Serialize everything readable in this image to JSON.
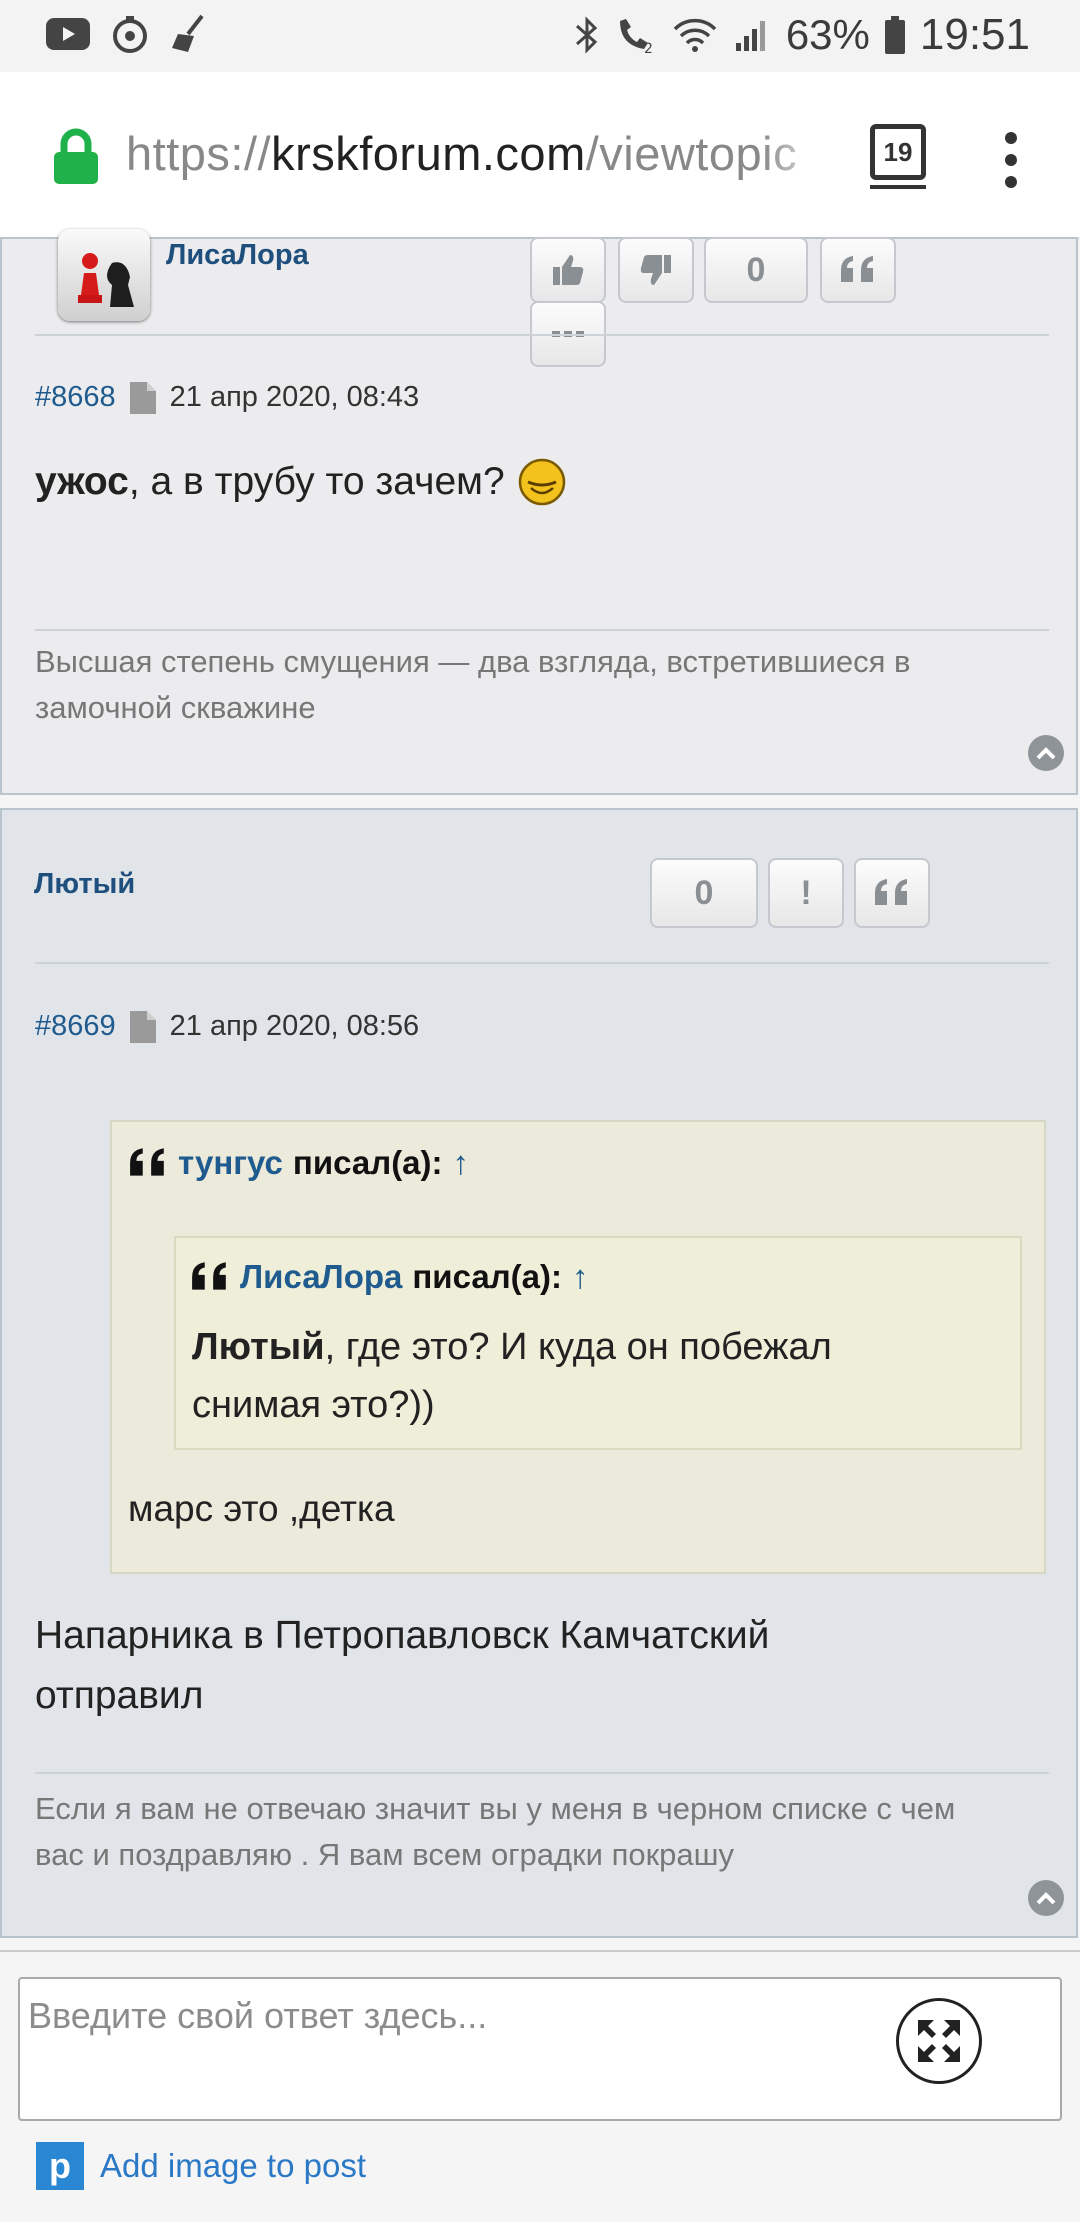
{
  "status_bar": {
    "battery": "63%",
    "time": "19:51"
  },
  "browser": {
    "url_prefix": "https://",
    "url_host": "krskforum.com",
    "url_path": "/viewtopic",
    "tab_count": "19",
    "accent": "#21b14a"
  },
  "post1": {
    "author": "ЛисаЛора",
    "vote_count": "0",
    "post_id": "#8668",
    "date": "21 апр 2020, 08:43",
    "body_bold": "ужос",
    "body_rest": ", а в трубу то зачем?",
    "signature": "Высшая степень смущения — два взгляда, встретившиеся в замочной скважине"
  },
  "post2": {
    "author": "Лютый",
    "vote_count": "0",
    "report_label": "!",
    "post_id": "#8669",
    "date": "21 апр 2020, 08:56",
    "quote_outer": {
      "name": "тунгус",
      "wrote": "писал(а):",
      "arrow": "↑",
      "text": "марс это ,детка"
    },
    "quote_inner": {
      "name": "ЛисаЛора",
      "wrote": "писал(а):",
      "arrow": "↑",
      "text_bold": "Лютый",
      "text_line1": ", где это? И куда он побежал",
      "text_line2": "снимая это?))"
    },
    "body_line1": "Напарника в Петропавловск Камчатский",
    "body_line2": "отправил",
    "signature_line1": "Если я вам не отвечаю значит вы у меня в черном списке с чем",
    "signature_line2": "вас и поздравляю . Я вам всем оградки покрашу"
  },
  "reply": {
    "placeholder": "Введите свой ответ здесь...",
    "add_image_label": "Add image to post"
  }
}
